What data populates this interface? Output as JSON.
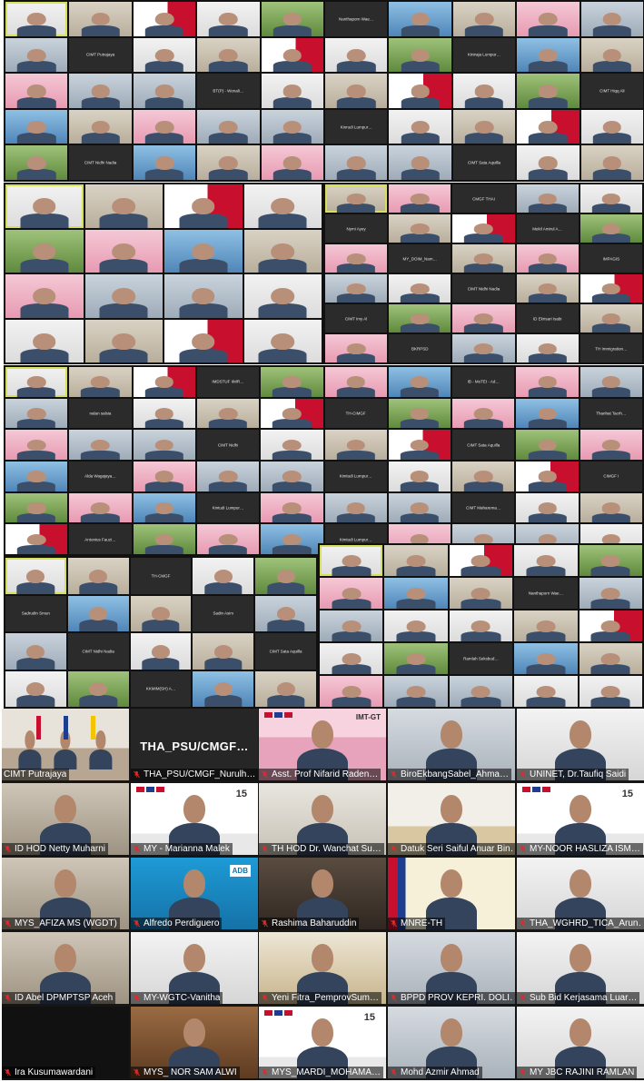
{
  "screenshot_panels": {
    "panel_a_captions": [
      "Nanthaporn Wae…",
      "CIMT Putrajaya",
      "Kiniraja Lumpur…",
      "BT(P) - Wenali…",
      "CIMT Hiqq Ali",
      "Kinrudi Lumpur…",
      "CIMT Nidhi Nadia",
      "CIMT Sata Aquilla",
      "TH_CIMGF (Nurrn…"
    ],
    "panel_b_captions": [
      "CMGF THAI",
      "Nymi Ayey",
      "Mekil Amirul A…",
      "MY_DOIM_Nam…",
      "IMPAGIS",
      "CIMT Nidhi Nadia",
      "CIMT Imy Al",
      "ID Ekrisari Isabi",
      "BKRPSD",
      "TH Immigration…",
      "THAI DUEMME…"
    ],
    "panel_c_captions": [
      "IMDSTUF IIMR…",
      "IB - MoTEI - Ad…",
      "nalan salsia",
      "TH-CIMGF",
      "Thanhat Tacrh…",
      "CIMT Nidhi",
      "CIMT Sata Aquilla",
      "Alda Wagajaya…",
      "Kimtudi Lumpur…",
      "CIMGF I",
      "Kintudi Lumpur…",
      "CIMT Maharema…",
      "Antonius Fauzi…",
      "Kimtudi Lumpur…"
    ],
    "panel_d_captions": [
      "TH-CMGF",
      "Sadrudin Smun",
      "Sadin Asim",
      "CIMT Nidhi Nadia",
      "CIMT Sata Aquilla",
      "KKMIM(SH) A…",
      "Kimtudi Lumpur…",
      "Kimtudi Lumpur…"
    ],
    "panel_e_captions": [
      "Nanthaporn Wae…",
      "Ramlah Seksbud…",
      "CIMT Putrajaya"
    ]
  },
  "gallery": {
    "tiles": [
      {
        "caption": "CIMT Putrajaya",
        "muted": false,
        "active": true,
        "scene": "conference-room-flags"
      },
      {
        "caption": "THA_PSU/CMGF_Nurulh…",
        "name_display": "THA_PSU/CMGF…",
        "muted": true,
        "active": false,
        "scene": "video-off"
      },
      {
        "caption": "Asst. Prof Nifarid Raden…",
        "muted": true,
        "active": false,
        "scene": "pink-banner"
      },
      {
        "caption": "BiroEkbangSabel_Ahma…",
        "muted": true,
        "active": false,
        "scene": "office"
      },
      {
        "caption": "UNINET, Dr.Taufiq Saidi",
        "muted": true,
        "active": false,
        "scene": "white-wall"
      },
      {
        "caption": "ID HOD Netty Muharni",
        "muted": true,
        "active": false,
        "scene": "room"
      },
      {
        "caption": "MY - Marianna Malek",
        "muted": true,
        "active": false,
        "scene": "imt-banner"
      },
      {
        "caption": "TH HOD Dr. Wanchat Su…",
        "muted": true,
        "active": false,
        "scene": "thai-backdrop"
      },
      {
        "caption": "Datuk Seri Saiful Anuar Bin…",
        "muted": true,
        "active": false,
        "scene": "building"
      },
      {
        "caption": "MY-NOOR HASLIZA ISM…",
        "muted": true,
        "active": false,
        "scene": "imt-banner"
      },
      {
        "caption": "MYS_AFIZA MS (WGDT)",
        "muted": true,
        "active": false,
        "scene": "room"
      },
      {
        "caption": "Alfredo Perdiguero",
        "muted": true,
        "active": false,
        "scene": "adb-blue"
      },
      {
        "caption": "Rashima Baharuddin",
        "muted": true,
        "active": false,
        "scene": "dark-room"
      },
      {
        "caption": "MNRE-TH",
        "muted": true,
        "active": false,
        "scene": "ministry-banner"
      },
      {
        "caption": "THA_WGHRD_TICA_Arun…",
        "muted": true,
        "active": false,
        "scene": "white-wall"
      },
      {
        "caption": "ID Abel DPMPTSP Aceh",
        "muted": true,
        "active": false,
        "scene": "room"
      },
      {
        "caption": "MY-WGTC-Vanitha",
        "muted": true,
        "active": false,
        "scene": "white-wall"
      },
      {
        "caption": "Yeni Fitra_PemprovSum…",
        "muted": true,
        "active": false,
        "scene": "ceiling"
      },
      {
        "caption": "BPPD PROV KEPRI. DOLI…",
        "muted": true,
        "active": false,
        "scene": "office"
      },
      {
        "caption": "Sub Bid Kerjasama Luar…",
        "muted": true,
        "active": false,
        "scene": "white-wall"
      },
      {
        "caption": "Ira Kusumawardani",
        "muted": true,
        "active": false,
        "scene": "black"
      },
      {
        "caption": "MYS_ NOR SAM ALWI",
        "muted": true,
        "active": false,
        "scene": "wood-room"
      },
      {
        "caption": "MYS_MARDI_MOHAMA…",
        "muted": true,
        "active": false,
        "scene": "imt-banner"
      },
      {
        "caption": "Mohd Azmir Ahmad",
        "muted": true,
        "active": false,
        "scene": "office"
      },
      {
        "caption": "MY JBC RAJINI RAMLAN",
        "muted": true,
        "active": false,
        "scene": "white-wall"
      }
    ],
    "banner_text": {
      "imt": "IMT-GT",
      "adb": "ADB",
      "num": "15"
    }
  },
  "colors": {
    "active_outline": "#c9e04c",
    "muted_icon": "#e02b2b",
    "gallery_bg": "#161616"
  }
}
